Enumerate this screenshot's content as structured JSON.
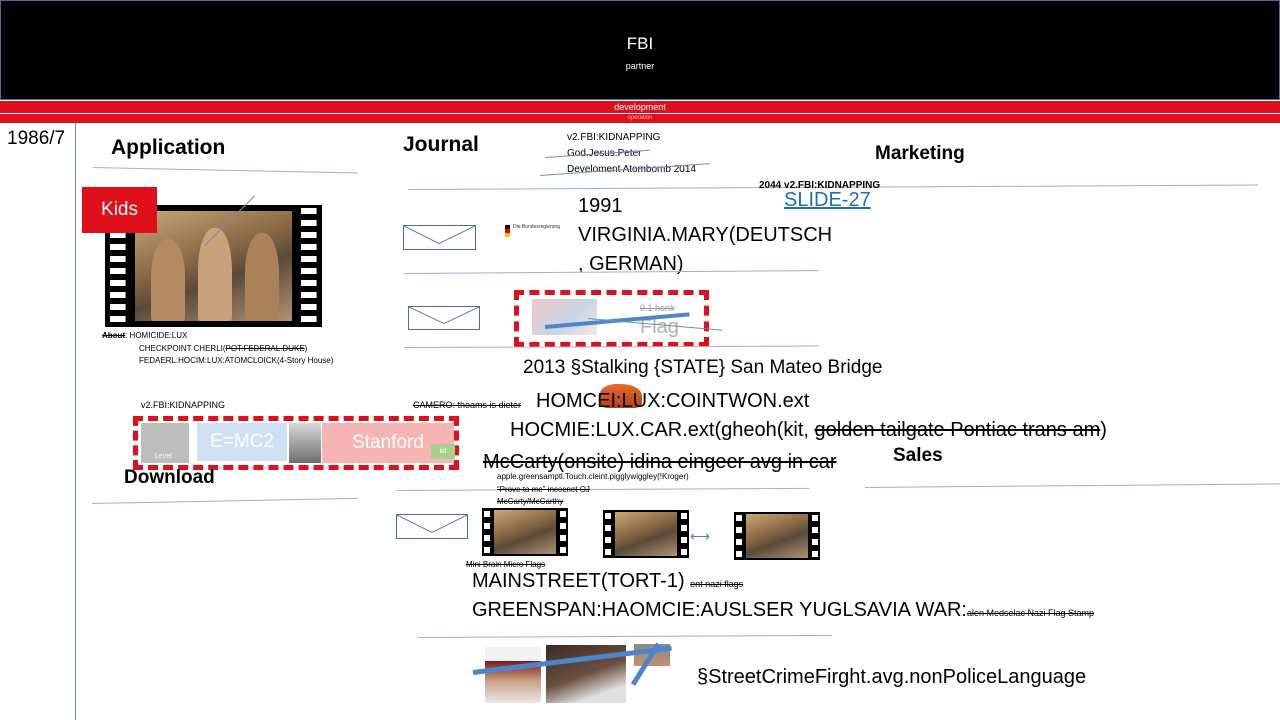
{
  "header": {
    "title": "FBI",
    "subtitle": "partner"
  },
  "bars": {
    "bar1": "development",
    "bar2": "operation"
  },
  "date_label": "1986/7",
  "sections": {
    "application": "Application",
    "journal": "Journal",
    "marketing": "Marketing",
    "download": "Download",
    "sales": "Sales"
  },
  "journal_notes": {
    "line1": "v2.FBI:KIDNAPPING",
    "line2": "God.Jesus.Peter",
    "line3": "Develoment  Atombomb   2014"
  },
  "marketing": {
    "note": "2044 v2.FBI:KIDNAPPING",
    "link": "SLIDE-27"
  },
  "kids_badge": "Kids",
  "about": {
    "label": "About",
    "line1": ": HOMICIDE:LUX",
    "line2_a": "CHECKPOINT CHERLI(",
    "line2_strike": "POT:FEDERAL.DUKE",
    "line2_b": ")",
    "line3": "FEDAERL:HOCIM:LUX:ATOMCLOICK(4-Story House)"
  },
  "bundes_label": "Die Bundesregierung",
  "entry_1991": {
    "line1": "1991",
    "line2": "VIRGINIA.MARY(DEUTSCH",
    "line3": ", GERMAN)"
  },
  "flag_box": {
    "hank": "0.1 honk",
    "flag": "Flag"
  },
  "stalking": "2013 §Stalking {STATE} San Mateo Bridge",
  "camero": "CAMERO: thoams is dieter",
  "homcei": "HOMCEI:LUX:COINTWON.ext",
  "hocmie_a": "HOCMIE:LUX.CAR.ext(gheoh(kit, ",
  "hocmie_strike": "golden tailgate Pontiac trans am",
  "hocmie_b": ")",
  "mccarty_strike": "McCarty(onsite) idina eingeer avg in car",
  "v2_kidnapping": "v2.FBI:KIDNAPPING",
  "download_box": {
    "level": "Level",
    "emc2": "E=MC2",
    "stanford": "Stanford",
    "kit": "kit"
  },
  "apple": {
    "line1": "apple.greensamptl.Touch.cleint.pigglywiggley(!Kroger)",
    "line2": "“Prove to me” incecnet OJ",
    "line3": "McCarty/McCarthy"
  },
  "mini_brain": "Mini Brain Micro Flags",
  "mainstreet": "MAINSTREET(TORT-1)",
  "mainstreet_small": "ent nazi flags",
  "greenspan": "GREENSPAN:HAOMCIE:AUSLSER YUGLSAVIA WAR:",
  "greenspan_small": "alen Medselac Nazi Flag Stamp",
  "streetcrime": "§StreetCrimeFirght.avg.nonPoliceLanguage",
  "colors": {
    "red": "#e0101a",
    "accent_blue": "#4a86c8",
    "link": "#1f6fb5"
  }
}
